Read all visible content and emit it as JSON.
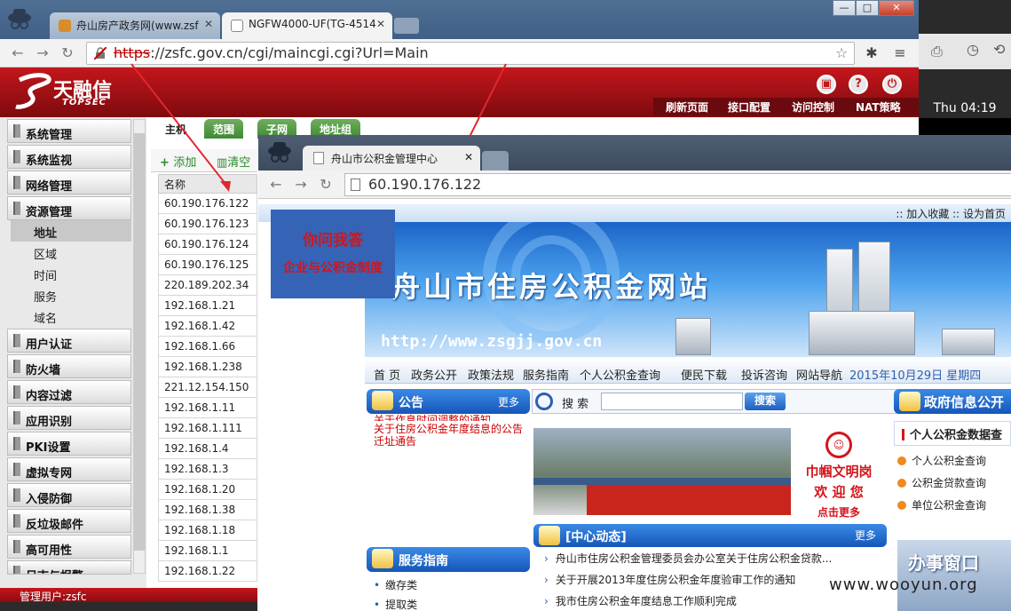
{
  "browser1": {
    "tabs": [
      {
        "label": "舟山房产政务网(www.zsf"
      },
      {
        "label": "NGFW4000-UF(TG-4514"
      }
    ],
    "window_controls": [
      "—",
      "□",
      "✕"
    ],
    "url": {
      "scheme": "https",
      "rest": "://zsfc.gov.cn/cgi/maincgi.cgi?Url=Main"
    }
  },
  "topsec": {
    "logo_cn": "天融信",
    "logo_en": "TOPSEC",
    "header_links": [
      "刷新页面",
      "接口配置",
      "访问控制",
      "NAT策略"
    ],
    "header_icons": [
      "save-icon",
      "help-icon",
      "logout-icon"
    ],
    "sidebar": {
      "before": [
        "系统管理",
        "系统监视",
        "网络管理",
        "资源管理"
      ],
      "sub": [
        "地址",
        "区域",
        "时间",
        "服务",
        "域名"
      ],
      "selected_sub": "地址",
      "after": [
        "用户认证",
        "防火墙",
        "内容过滤",
        "应用识别",
        "PKI设置",
        "虚拟专网",
        "入侵防御",
        "反垃圾邮件",
        "高可用性",
        "日志与报警"
      ]
    },
    "content_tabs": [
      "主机",
      "范围",
      "子网",
      "地址组"
    ],
    "actions": {
      "add": "添加",
      "clear": "清空"
    },
    "column_header": "名称",
    "rows": [
      "60.190.176.122",
      "60.190.176.123",
      "60.190.176.124",
      "60.190.176.125",
      "220.189.202.34",
      "192.168.1.21",
      "192.168.1.42",
      "192.168.1.66",
      "192.168.1.238",
      "221.12.154.150",
      "192.168.1.11",
      "192.168.1.111",
      "192.168.1.4",
      "192.168.1.3",
      "192.168.1.20",
      "192.168.1.38",
      "192.168.1.18",
      "192.168.1.1",
      "192.168.1.22"
    ],
    "status": "管理用户:zsfc"
  },
  "desktop": {
    "clock": "Thu 04:19"
  },
  "browser2": {
    "tab": "舟山市公积金管理中心",
    "url": "60.190.176.122"
  },
  "site": {
    "top_links": ":: 加入收藏 :: 设为首页",
    "ask": {
      "line1": "你问我答",
      "line2": "企业与公积金制度"
    },
    "banner_title": "舟山市住房公积金网站",
    "banner_url": "http://www.zsgjj.gov.cn",
    "nav": [
      "首 页",
      "政务公开",
      "政策法规",
      "服务指南",
      "个人公积金查询",
      "便民下载",
      "投诉咨询",
      "网站导航"
    ],
    "date": "2015年10月29日 星期四",
    "notice": {
      "title": "公告",
      "more": "更多",
      "items": [
        "关于作息时间调整的通知",
        "关于住房公积金年度结息的公告",
        "迁址通告"
      ]
    },
    "search": {
      "label": "搜 索",
      "button": "搜索"
    },
    "civility": {
      "line1": "巾帼文明岗",
      "line2": "欢 迎 您",
      "line3": "点击更多"
    },
    "news": {
      "title": "[中心动态]",
      "more": "更多",
      "items": [
        "舟山市住房公积金管理委员会办公室关于住房公积金贷款...",
        "关于开展2013年度住房公积金年度验审工作的通知",
        "我市住房公积金年度结息工作顺利完成"
      ]
    },
    "service": {
      "title": "服务指南",
      "items": [
        "缴存类",
        "提取类"
      ]
    },
    "gov": {
      "title": "政府信息公开",
      "sub": "个人公积金数据查",
      "links": [
        "个人公积金查询",
        "公积金贷款查询",
        "单位公积金查询"
      ]
    },
    "office": "办事窗口"
  },
  "watermark": "www.wooyun.org",
  "colors": {
    "topsec_red": "#c4161c",
    "site_blue": "#1656b8",
    "notice_red": "#cc0000"
  }
}
